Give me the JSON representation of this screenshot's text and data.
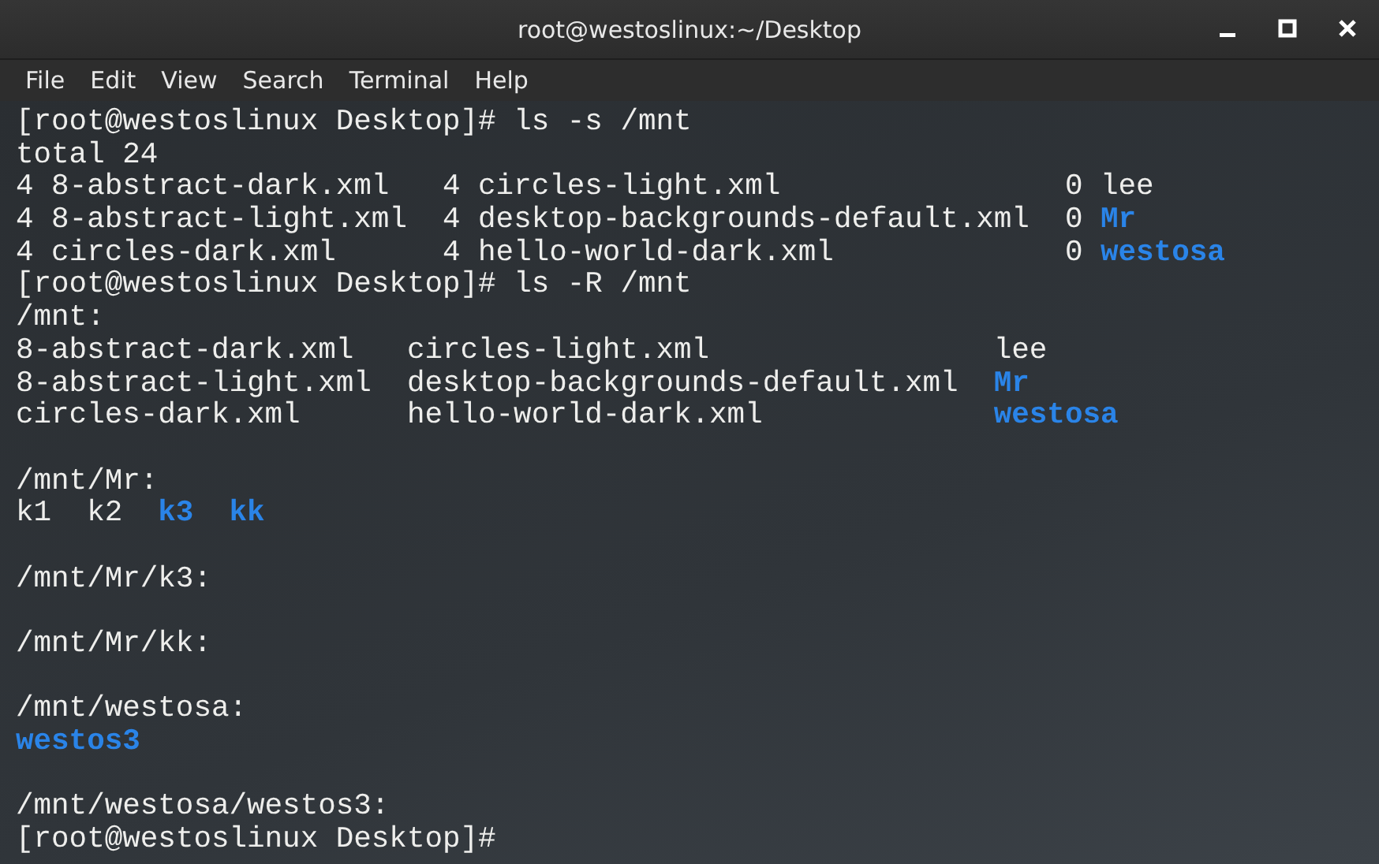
{
  "window": {
    "title": "root@westoslinux:~/Desktop"
  },
  "menu": [
    "File",
    "Edit",
    "View",
    "Search",
    "Terminal",
    "Help"
  ],
  "terminal": [
    {
      "kind": "prompt",
      "text": "[root@westoslinux Desktop]# ls -s /mnt"
    },
    {
      "kind": "text",
      "text": "total 24"
    },
    {
      "kind": "grid",
      "rows": [
        [
          {
            "size": "4",
            "name": "8-abstract-dark.xml",
            "kind": "file"
          },
          {
            "size": "4",
            "name": "circles-light.xml",
            "kind": "file"
          },
          {
            "size": "0",
            "name": "lee",
            "kind": "file"
          }
        ],
        [
          {
            "size": "4",
            "name": "8-abstract-light.xml",
            "kind": "file"
          },
          {
            "size": "4",
            "name": "desktop-backgrounds-default.xml",
            "kind": "file"
          },
          {
            "size": "0",
            "name": "Mr",
            "kind": "dir"
          }
        ],
        [
          {
            "size": "4",
            "name": "circles-dark.xml",
            "kind": "file"
          },
          {
            "size": "4",
            "name": "hello-world-dark.xml",
            "kind": "file"
          },
          {
            "size": "0",
            "name": "westosa",
            "kind": "dir"
          }
        ]
      ]
    },
    {
      "kind": "prompt",
      "text": "[root@westoslinux Desktop]# ls -R /mnt"
    },
    {
      "kind": "text",
      "text": "/mnt:"
    },
    {
      "kind": "grid",
      "rows": [
        [
          {
            "name": "8-abstract-dark.xml",
            "kind": "file"
          },
          {
            "name": "circles-light.xml",
            "kind": "file"
          },
          {
            "name": "lee",
            "kind": "file"
          }
        ],
        [
          {
            "name": "8-abstract-light.xml",
            "kind": "file"
          },
          {
            "name": "desktop-backgrounds-default.xml",
            "kind": "file"
          },
          {
            "name": "Mr",
            "kind": "dir"
          }
        ],
        [
          {
            "name": "circles-dark.xml",
            "kind": "file"
          },
          {
            "name": "hello-world-dark.xml",
            "kind": "file"
          },
          {
            "name": "westosa",
            "kind": "dir"
          }
        ]
      ]
    },
    {
      "kind": "blank"
    },
    {
      "kind": "text",
      "text": "/mnt/Mr:"
    },
    {
      "kind": "grid",
      "rows": [
        [
          {
            "name": "k1",
            "kind": "file"
          },
          {
            "name": "k2",
            "kind": "file"
          },
          {
            "name": "k3",
            "kind": "dir"
          },
          {
            "name": "kk",
            "kind": "dir"
          }
        ]
      ]
    },
    {
      "kind": "blank"
    },
    {
      "kind": "text",
      "text": "/mnt/Mr/k3:"
    },
    {
      "kind": "blank"
    },
    {
      "kind": "text",
      "text": "/mnt/Mr/kk:"
    },
    {
      "kind": "blank"
    },
    {
      "kind": "text",
      "text": "/mnt/westosa:"
    },
    {
      "kind": "grid",
      "rows": [
        [
          {
            "name": "westos3",
            "kind": "dir"
          }
        ]
      ]
    },
    {
      "kind": "blank"
    },
    {
      "kind": "text",
      "text": "/mnt/westosa/westos3:"
    },
    {
      "kind": "prompt",
      "text": "[root@westoslinux Desktop]#"
    }
  ]
}
